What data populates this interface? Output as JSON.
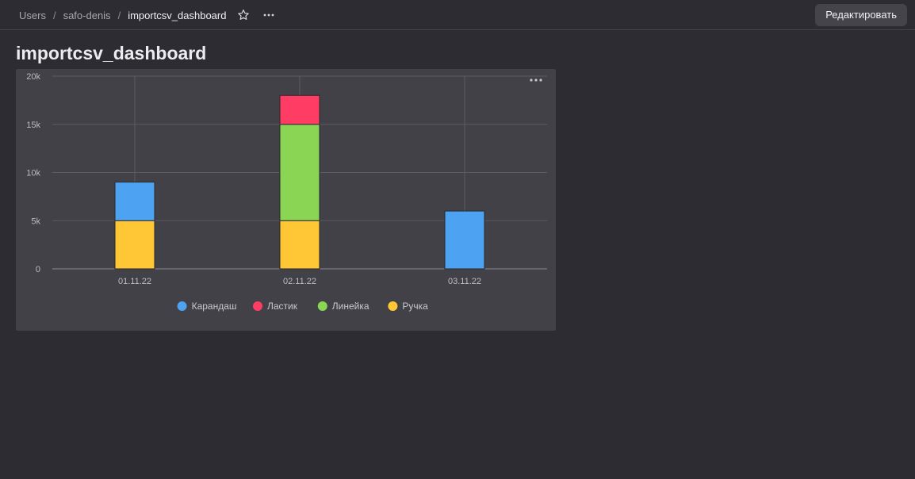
{
  "breadcrumbs": [
    {
      "label": "Users"
    },
    {
      "label": "safo-denis"
    },
    {
      "label": "importcsv_dashboard"
    }
  ],
  "header": {
    "edit_label": "Редактировать",
    "star_icon": "star-icon",
    "more_icon": "more-dots-icon"
  },
  "page_title": "importcsv_dashboard",
  "chart_data": {
    "type": "bar",
    "stacked": true,
    "categories": [
      "01.11.22",
      "02.11.22",
      "03.11.22"
    ],
    "series": [
      {
        "name": "Карандаш",
        "color": "#4da2f1",
        "values": [
          4000,
          0,
          6000
        ]
      },
      {
        "name": "Ластик",
        "color": "#ff3d64",
        "values": [
          0,
          3000,
          0
        ]
      },
      {
        "name": "Линейка",
        "color": "#8ad554",
        "values": [
          0,
          10000,
          0
        ]
      },
      {
        "name": "Ручка",
        "color": "#ffc636",
        "values": [
          5000,
          5000,
          0
        ]
      }
    ],
    "stack_order": [
      "Ручка",
      "Линейка",
      "Карандаш",
      "Ластик"
    ],
    "ylim": [
      0,
      20000
    ],
    "yticks": [
      {
        "value": 0,
        "label": "0"
      },
      {
        "value": 5000,
        "label": "5k"
      },
      {
        "value": 10000,
        "label": "10k"
      },
      {
        "value": 15000,
        "label": "15k"
      },
      {
        "value": 20000,
        "label": "20k"
      }
    ],
    "grid": true,
    "legend_position": "bottom"
  }
}
